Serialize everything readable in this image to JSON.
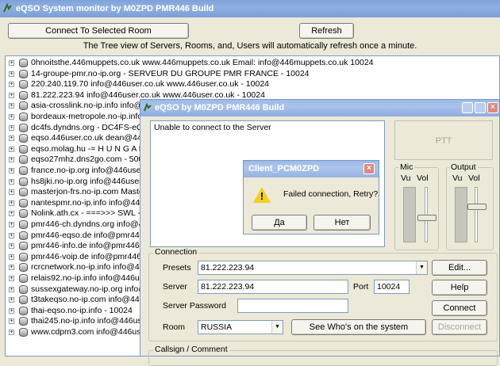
{
  "main": {
    "title": "eQSO System monitor by M0ZPD PMR446 Build",
    "connect_button": "Connect To Selected Room",
    "refresh_button": "Refresh",
    "info_text": "The Tree view of Servers, Rooms, and, Users will automatically refresh once a minute.",
    "tree_items": [
      "0hnoitsthe.446muppets.co.uk  www.446muppets.co.uk   Email: info@446muppets.co.uk   10024",
      "14-groupe-pmr.no-ip.org - SERVEUR DU GROUPE PMR FRANCE  - 10024",
      "220.240.119.70 info@446user.co.uk www.446user.co.uk - 10024",
      "81.222.223.94 info@446user.co.uk www.446user.co.uk - 10024",
      "asia-crosslink.no-ip.info info@4",
      "bordeaux-metropole.no-ip.info in",
      "dc4fs.dyndns.org - DC4FS-eQSO",
      "eqso.446user.co.uk dean@446u",
      "eqso.molag.hu -= H U N G A R Y",
      "eqso27mhz.dns2go.com  - 500",
      "france.no-ip.org info@446user.co",
      "hs8jki.no-ip.org info@446user.co",
      "masterjon-frs.no-ip.com Masterjo",
      "nantespmr.no-ip.info info@446us",
      "Nolink.ath.cx -     ===>>>  SWL - S",
      "pmr446-ch.dyndns.org info@446u",
      "pmr446-eqso.de info@pmr446-e",
      "pmr446-info.de info@pmr446-inf",
      "pmr446-voip.de info@pmr446-vo",
      "rcrcnetwork.no-ip.info info@446us",
      "relais92.no-ip.info info@446user.",
      "sussexgateway.no-ip.org info@44",
      "t3takeqso.no-ip.com info@446us",
      "thai-eqso.no-ip.info  - 10024",
      "thai245.no-ip.info info@446user.c",
      "www.cdpm3.com info@446user.co"
    ]
  },
  "client": {
    "title": "eQSO by M0ZPD PMR446 Build",
    "status_text": "Unable to connect to the Server",
    "ptt_button": "PTT",
    "mic_label": "Mic",
    "output_label": "Output",
    "vu_label": "Vu",
    "vol_label": "Vol",
    "connection_group": "Connection",
    "presets_label": "Presets",
    "presets_value": "81.222.223.94",
    "edit_button": "Edit...",
    "server_label": "Server",
    "server_value": "81.222.223.94",
    "port_label": "Port",
    "port_value": "10024",
    "help_button": "Help",
    "password_label": "Server Password",
    "password_value": "",
    "connect_button": "Connect",
    "room_label": "Room",
    "room_value": "RUSSIA",
    "whos_on_button": "See Who's on the system",
    "disconnect_button": "Disconnect",
    "callsign_group": "Callsign / Comment"
  },
  "dialog": {
    "title": "Client_PCM0ZPD",
    "message": "Failed connection, Retry?",
    "yes_button": "Да",
    "no_button": "Нет"
  },
  "colors": {
    "titlebar": "#7ea1d8",
    "window_bg": "#ece9d8",
    "warning": "#f5d015"
  }
}
